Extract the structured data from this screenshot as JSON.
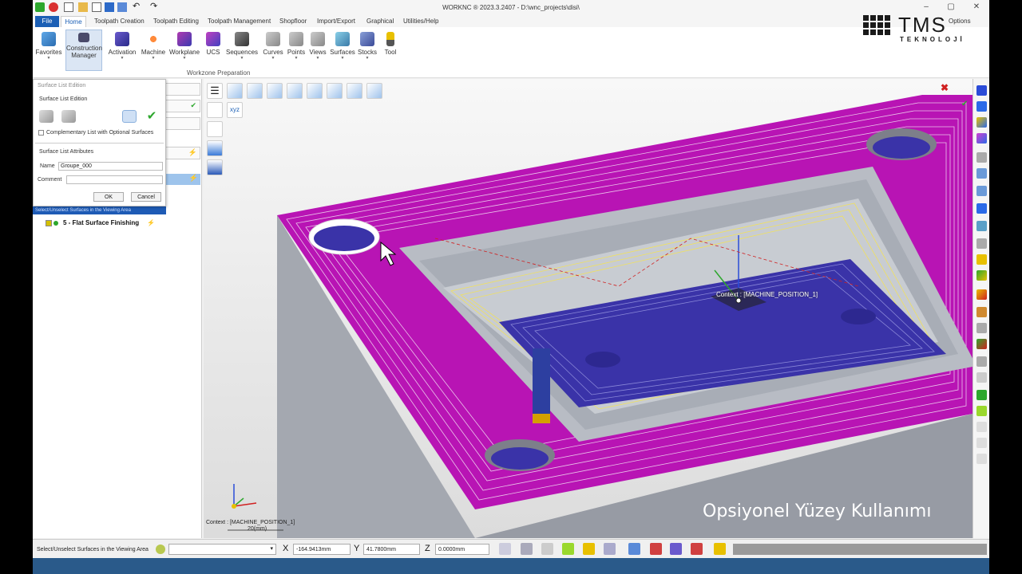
{
  "window": {
    "title": "WORKNC ® 2023.3.2407 - D:\\wnc_projects\\disi\\",
    "options_label": "Options"
  },
  "menu": {
    "file": "File",
    "home": "Home",
    "items": [
      "Toolpath Creation",
      "Toolpath Editing",
      "Toolpath Management",
      "Shopfloor",
      "Import/Export",
      "Graphical",
      "Utilities/Help"
    ]
  },
  "ribbon": {
    "buttons": [
      {
        "label": "Favorites",
        "icon": "favorites-icon"
      },
      {
        "label": "Construction",
        "label2": "Manager",
        "icon": "construction-manager-icon"
      },
      {
        "label": "Activation",
        "icon": "activation-icon"
      },
      {
        "label": "Machine",
        "icon": "machine-icon"
      },
      {
        "label": "Workplane",
        "icon": "workplane-icon"
      },
      {
        "label": "UCS",
        "icon": "ucs-icon"
      },
      {
        "label": "Sequences",
        "icon": "sequences-icon"
      },
      {
        "label": "Curves",
        "icon": "curves-icon"
      },
      {
        "label": "Points",
        "icon": "points-icon"
      },
      {
        "label": "Views",
        "icon": "views-icon"
      },
      {
        "label": "Surfaces",
        "icon": "surfaces-icon"
      },
      {
        "label": "Stocks",
        "icon": "stocks-icon"
      },
      {
        "label": "Tool",
        "icon": "tool-icon"
      }
    ],
    "group_label": "Workzone Preparation"
  },
  "logo": {
    "main": "TMS",
    "sub": "TEKNOLOJİ"
  },
  "dialog": {
    "title": "Surface List Edition",
    "section1": "Surface List Edition",
    "checkbox_label": "Complementary List with Optional Surfaces",
    "section2": "Surface List Attributes",
    "name_label": "Name",
    "name_value": "Groupe_000",
    "comment_label": "Comment",
    "comment_value": "",
    "ok": "OK",
    "cancel": "Cancel"
  },
  "left_panel": {
    "tooltip": "Select/Unselect Surfaces in the Viewing Area",
    "item5": "5 - Flat Surface Finishing"
  },
  "viewport": {
    "context_label": "Context : [MACHINE_POSITION_1]",
    "bottom_context": "Context : [MACHINE_POSITION_1]",
    "scale": "20(mm)",
    "caption": "Opsiyonel Yüzey Kullanımı",
    "axis_x": "X",
    "axis_y": "Y",
    "axis_z": "Z",
    "colors": {
      "top_face": "#b814b4",
      "pocket_floor": "#3a33a8",
      "walls": "#9ea3ad",
      "toolpath": "#f0e060"
    }
  },
  "status": {
    "text": "Select/Unselect Surfaces in the Viewing Area",
    "x_label": "X",
    "x_value": "-164.9413mm",
    "y_label": "Y",
    "y_value": "41.7800mm",
    "z_label": "Z",
    "z_value": "0.0000mm"
  }
}
